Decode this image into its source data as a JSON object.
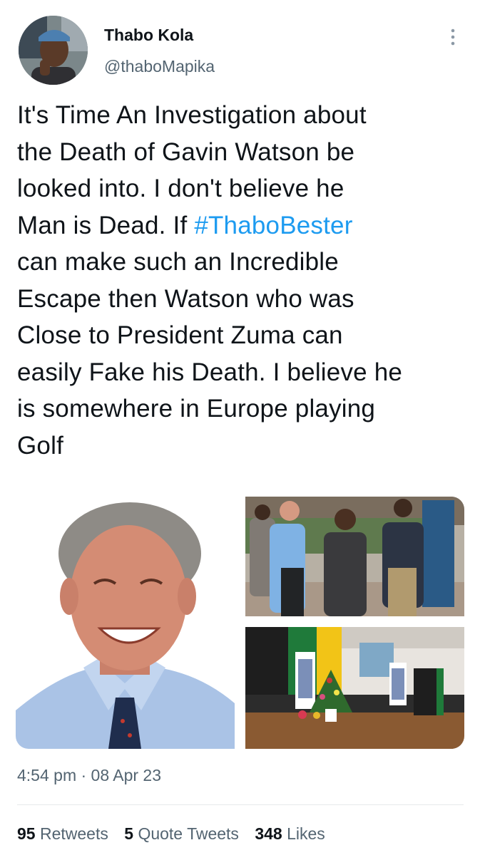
{
  "author": {
    "display_name": "Thabo Kola",
    "handle": "@thaboMapika"
  },
  "tweet": {
    "lines": [
      [
        {
          "text": "It's Time An Investigation about"
        }
      ],
      [
        {
          "text": "the Death of Gavin Watson be"
        }
      ],
      [
        {
          "text": "looked into. I don't believe he"
        }
      ],
      [
        {
          "text": "Man is Dead. If "
        },
        {
          "text": "#ThaboBester",
          "hashtag": true
        }
      ],
      [
        {
          "text": "can make such an Incredible"
        }
      ],
      [
        {
          "text": "Escape then Watson who was"
        }
      ],
      [
        {
          "text": "Close to President Zuma can"
        }
      ],
      [
        {
          "text": "easily Fake his Death. I believe he"
        }
      ],
      [
        {
          "text": "is somewhere in Europe playing"
        }
      ],
      [
        {
          "text": "Golf"
        }
      ]
    ],
    "timestamp": "4:54 pm · 08 Apr 23"
  },
  "stats": {
    "retweets_count": "95",
    "retweets_label": "Retweets",
    "quotes_count": "5",
    "quotes_label": "Quote Tweets",
    "likes_count": "348",
    "likes_label": "Likes"
  },
  "colors": {
    "link": "#1d9bf0",
    "secondary_text": "#536471",
    "primary_text": "#0f1419"
  },
  "icons": {
    "more": "more-vertical-icon"
  }
}
